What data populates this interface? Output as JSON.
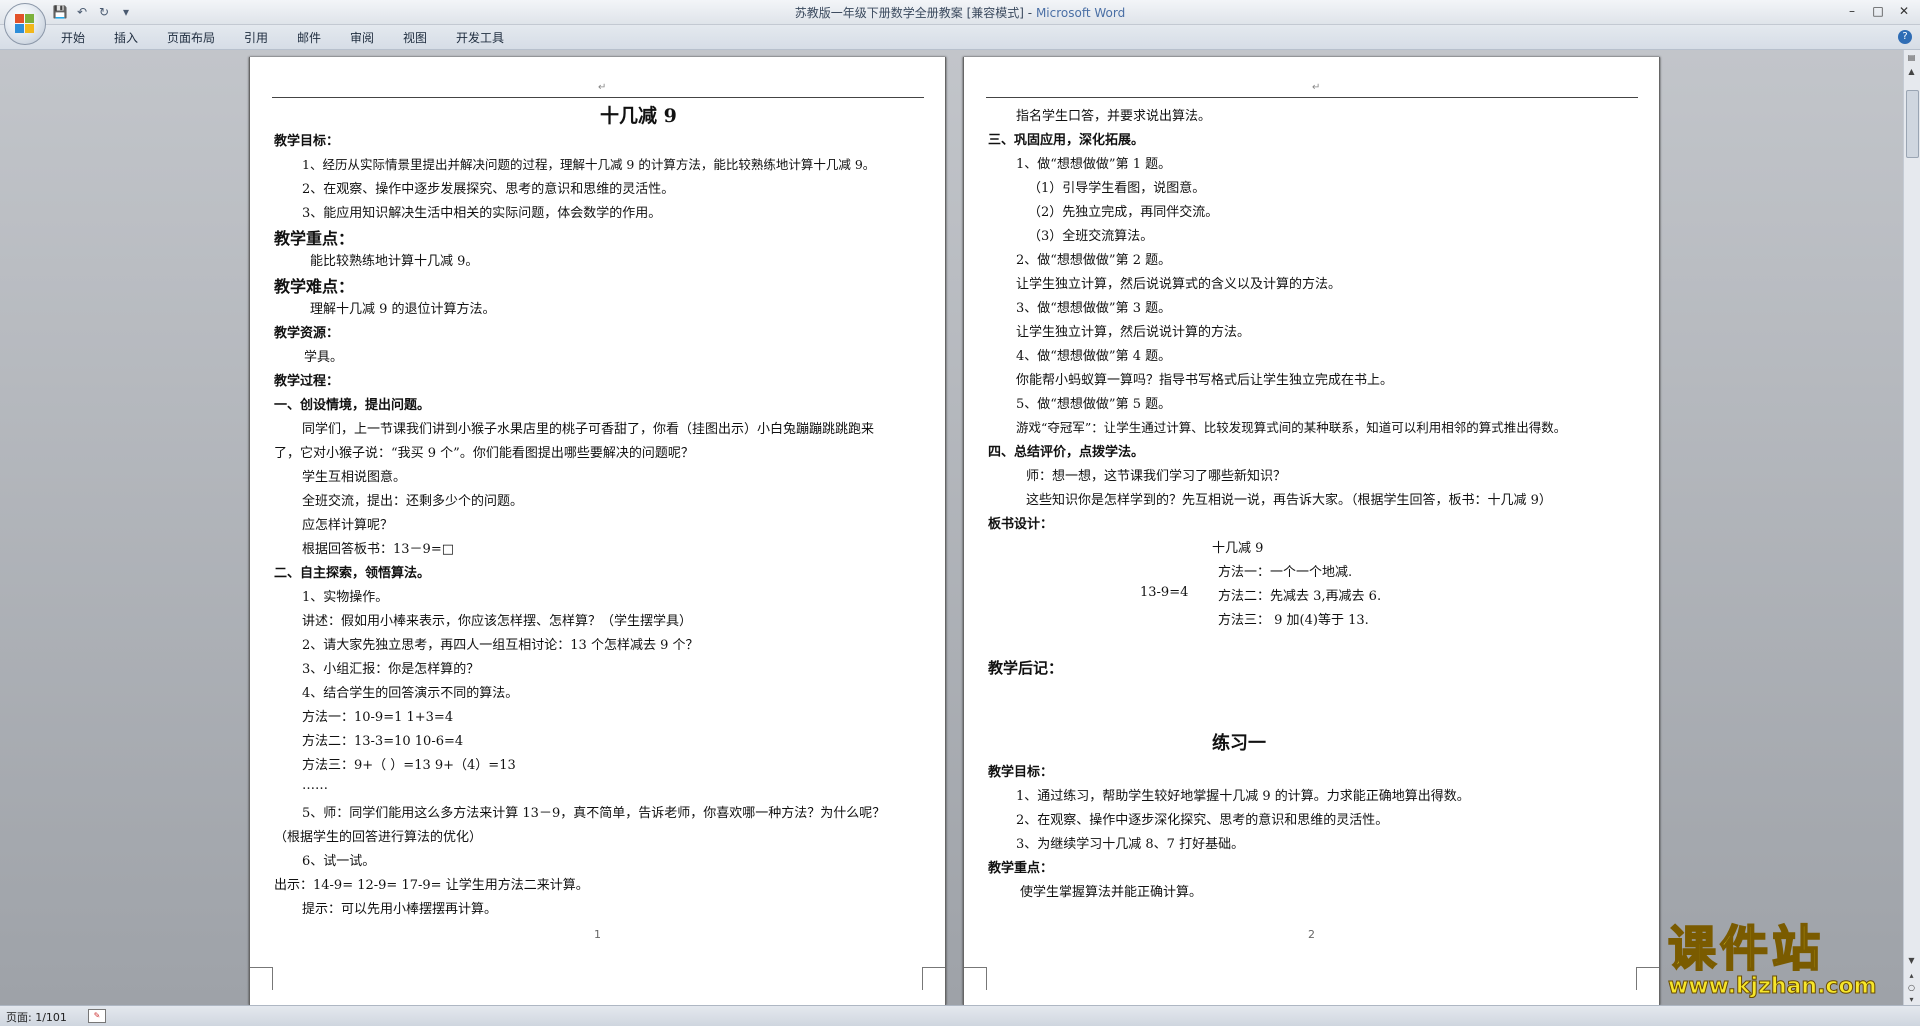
{
  "window": {
    "title_doc": "苏教版一年级下册数学全册教案 [兼容模式]",
    "title_sep": " - ",
    "title_app": "Microsoft Word"
  },
  "ribbon": {
    "tabs": [
      "开始",
      "插入",
      "页面布局",
      "引用",
      "邮件",
      "审阅",
      "视图",
      "开发工具"
    ]
  },
  "page1": {
    "title": "十几减 9",
    "lines": [
      "教学目标：",
      "1、经历从实际情景里提出并解决问题的过程，理解十几减 9 的计算方法，能比较熟练地计算十几减 9。",
      "2、在观察、操作中逐步发展探究、思考的意识和思维的灵活性。",
      "3、能应用知识解决生活中相关的实际问题，体会数学的作用。",
      "教学重点：",
      "能比较熟练地计算十几减 9。",
      "教学难点：",
      "理解十几减 9 的退位计算方法。",
      "教学资源：",
      "学具。",
      "教学过程：",
      "一、创设情境，提出问题。",
      "同学们，上一节课我们讲到小猴子水果店里的桃子可香甜了，你看（挂图出示）小白兔蹦蹦跳跳跑来",
      "了，它对小猴子说：“我买 9 个”。你们能看图提出哪些要解决的问题呢？",
      "学生互相说图意。",
      "全班交流，提出：还剩多少个的问题。",
      "应怎样计算呢？",
      "根据回答板书：13－9=□",
      "二、自主探索，领悟算法。",
      "1、实物操作。",
      "讲述：假如用小棒来表示，你应该怎样摆、怎样算？（学生摆学具）",
      "2、请大家先独立思考，再四人一组互相讨论：13 个怎样减去 9 个？",
      "3、小组汇报：你是怎样算的？",
      "4、结合学生的回答演示不同的算法。",
      "方法一：10-9=1    1+3=4",
      "方法二：13-3=10  10-6=4",
      "方法三：9+（ ）=13    9+（4）=13",
      "……",
      "5、师：同学们能用这么多方法来计算 13－9，真不简单，告诉老师，你喜欢哪一种方法？为什么呢？",
      "（根据学生的回答进行算法的优化）",
      "6、试一试。",
      "出示：14-9=     12-9=      17-9= 让学生用方法二来计算。",
      "提示：可以先用小棒摆摆再计算。"
    ],
    "page_number": "1"
  },
  "page2": {
    "lines": [
      "指名学生口答，并要求说出算法。",
      "三、巩固应用，深化拓展。",
      "1、做“想想做做”第 1 题。",
      "（1）引导学生看图，说图意。",
      "（2）先独立完成，再同伴交流。",
      "（3）全班交流算法。",
      "2、做“想想做做”第 2 题。",
      "让学生独立计算，然后说说算式的含义以及计算的方法。",
      "3、做“想想做做”第 3 题。",
      "让学生独立计算，然后说说计算的方法。",
      "4、做“想想做做”第 4 题。",
      "你能帮小蚂蚁算一算吗？指导书写格式后让学生独立完成在书上。",
      "5、做“想想做做”第 5 题。",
      "游戏“夺冠军”：让学生通过计算、比较发现算式间的某种联系，知道可以利用相邻的算式推出得数。",
      "四、总结评价，点拨学法。",
      "师：想一想，这节课我们学习了哪些新知识？",
      "这些知识你是怎样学到的？先互相说一说，再告诉大家。（根据学生回答，板书：十几减 9）",
      "板书设计："
    ],
    "board": {
      "title": "十几减 9",
      "m1": "方法一：一个一个地减.",
      "expr": "13-9=4",
      "m2": "方法二：先减去 3,再减去 6.",
      "m3": "方法三：  9 加(4)等于 13."
    },
    "postscript": "教学后记：",
    "title2": "练习一",
    "lines2": [
      "教学目标：",
      "1、通过练习，帮助学生较好地掌握十几减 9 的计算。力求能正确地算出得数。",
      "2、在观察、操作中逐步深化探究、思考的意识和思维的灵活性。",
      "3、为继续学习十几减 8、7 打好基础。",
      "教学重点：",
      "使学生掌握算法并能正确计算。"
    ],
    "page_number": "2"
  },
  "status": {
    "page": "页面: 1/101"
  },
  "watermark": {
    "big": "课件站",
    "small": "www.kjzhan.com"
  }
}
